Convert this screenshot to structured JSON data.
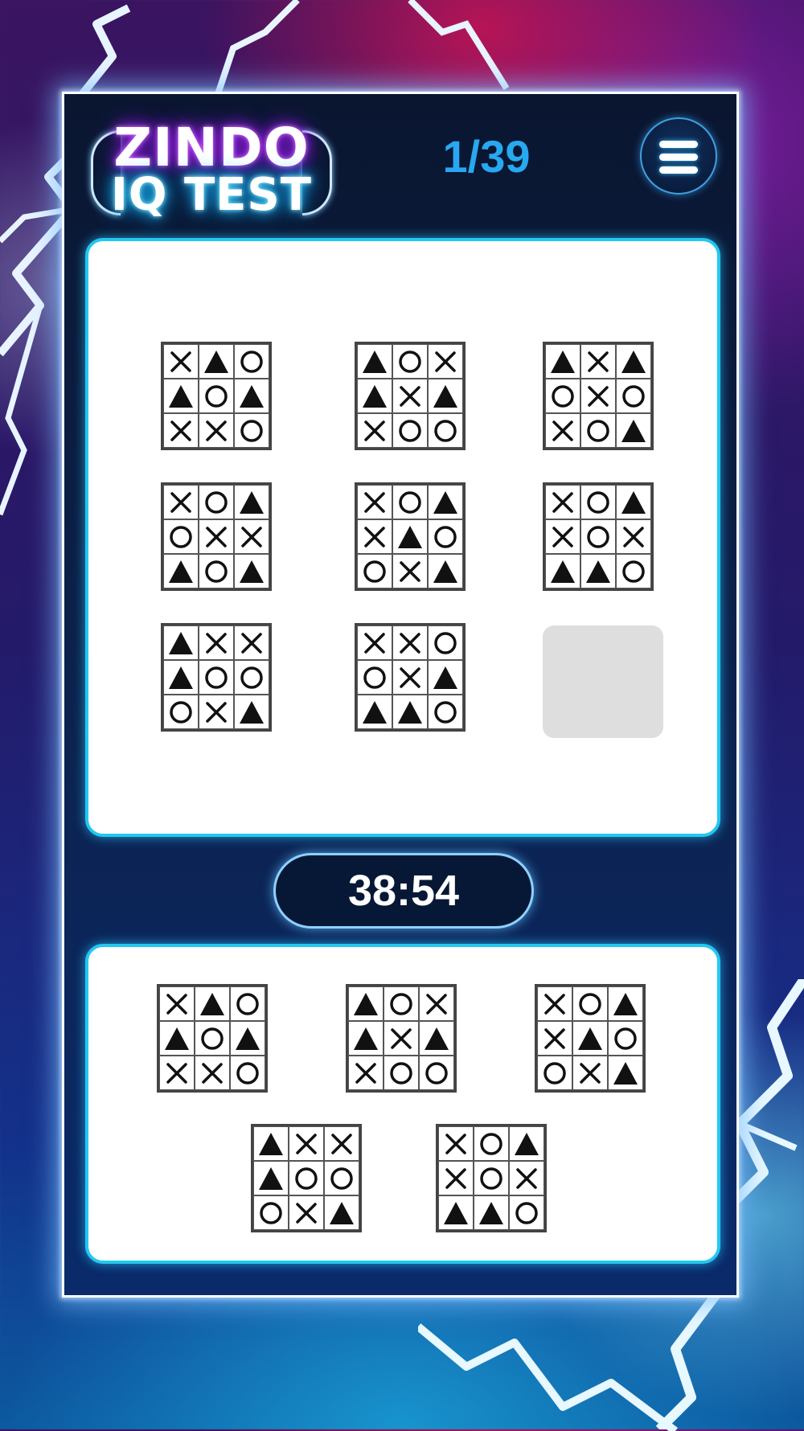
{
  "header": {
    "logo_line1": "ZINDO",
    "logo_line2": "IQ TEST",
    "question_counter": "1/39"
  },
  "timer": "38:54",
  "colors": {
    "card_border": "#22c8f0",
    "counter_text": "#28a8f0",
    "logo_line1_glow": "#a020f0",
    "logo_line2_glow": "#20c8ff",
    "placeholder": "#dedede"
  },
  "icons": {
    "menu": "hamburger-menu-icon",
    "x": "x-mark-icon",
    "o": "circle-icon",
    "t": "triangle-icon"
  },
  "question_grids": [
    [
      "X",
      "T",
      "O",
      "T",
      "O",
      "T",
      "X",
      "X",
      "O"
    ],
    [
      "T",
      "O",
      "X",
      "T",
      "X",
      "T",
      "X",
      "O",
      "O"
    ],
    [
      "T",
      "X",
      "T",
      "O",
      "X",
      "O",
      "X",
      "O",
      "T"
    ],
    [
      "X",
      "O",
      "T",
      "O",
      "X",
      "X",
      "T",
      "O",
      "T"
    ],
    [
      "X",
      "O",
      "T",
      "X",
      "T",
      "O",
      "O",
      "X",
      "T"
    ],
    [
      "X",
      "O",
      "T",
      "X",
      "O",
      "X",
      "T",
      "T",
      "O"
    ],
    [
      "T",
      "X",
      "X",
      "T",
      "O",
      "O",
      "O",
      "X",
      "T"
    ],
    [
      "X",
      "X",
      "O",
      "O",
      "X",
      "T",
      "T",
      "T",
      "O"
    ]
  ],
  "answer_options": [
    [
      "X",
      "T",
      "O",
      "T",
      "O",
      "T",
      "X",
      "X",
      "O"
    ],
    [
      "T",
      "O",
      "X",
      "T",
      "X",
      "T",
      "X",
      "O",
      "O"
    ],
    [
      "X",
      "O",
      "T",
      "X",
      "T",
      "O",
      "O",
      "X",
      "T"
    ],
    [
      "T",
      "X",
      "X",
      "T",
      "O",
      "O",
      "O",
      "X",
      "T"
    ],
    [
      "X",
      "O",
      "T",
      "X",
      "O",
      "X",
      "T",
      "T",
      "O"
    ]
  ]
}
